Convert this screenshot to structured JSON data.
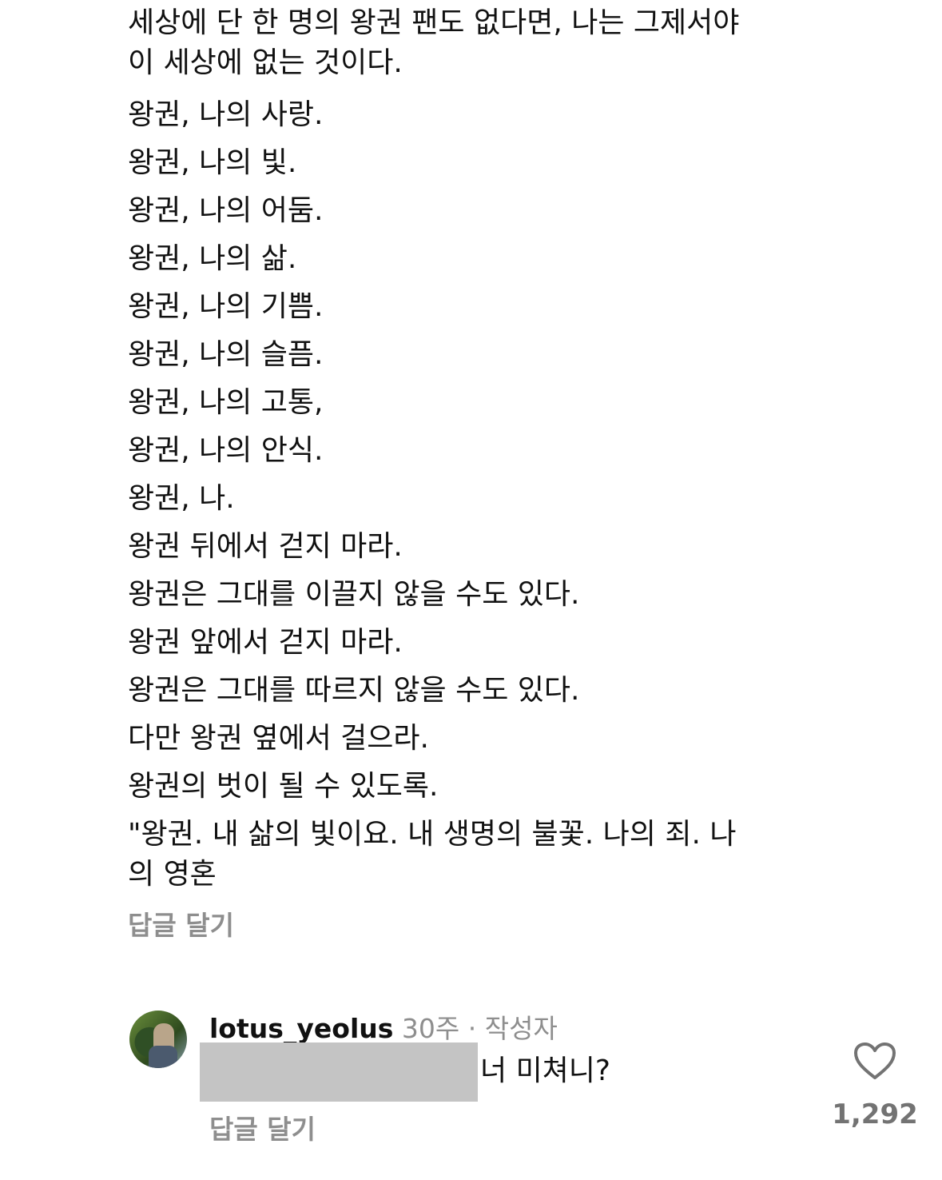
{
  "comment": {
    "first_lines": [
      "세상에 단 한 명의 왕권 팬도 없다면, 나는 그제서야",
      "이 세상에 없는 것이다."
    ],
    "lines": [
      "왕권, 나의 사랑.",
      "왕권, 나의 빛.",
      "왕권, 나의 어둠.",
      "왕권, 나의 삶.",
      "왕권, 나의 기쁨.",
      "왕권, 나의 슬픔.",
      "왕권, 나의 고통,",
      "왕권, 나의 안식.",
      "왕권, 나.",
      "왕권 뒤에서 걷지 마라.",
      "왕권은 그대를 이끌지 않을 수도 있다.",
      "왕권 앞에서 걷지 마라.",
      "왕권은 그대를 따르지 않을 수도 있다.",
      "다만 왕권 옆에서 걸으라.",
      "왕권의 벗이 될 수 있도록."
    ],
    "last_lines": [
      "\"왕권. 내 삶의 빛이요. 내 생명의 불꽃. 나의 죄. 나",
      "의 영혼"
    ],
    "reply_label": "답글 달기"
  },
  "reply": {
    "username": "lotus_yeolus",
    "time": "30주",
    "separator": "·",
    "author_badge": "작성자",
    "text": "너 미쳐니?",
    "reply_label": "답글 달기",
    "like_count": "1,292"
  },
  "icons": {
    "like": "heart-outline-icon",
    "avatar": "profile-photo"
  },
  "colors": {
    "text": "#111111",
    "muted": "#8e8e8e",
    "redaction": "#c4c4c4"
  }
}
